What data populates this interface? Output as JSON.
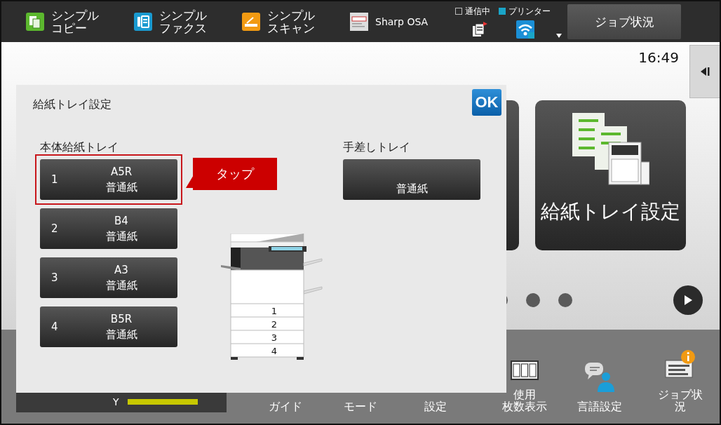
{
  "top_bar": {
    "apps": [
      {
        "label": [
          "シンプル",
          "コピー"
        ],
        "kind": "copy"
      },
      {
        "label": [
          "シンプル",
          "ファクス"
        ],
        "kind": "fax"
      },
      {
        "label": [
          "シンプル",
          "スキャン"
        ],
        "kind": "scan"
      },
      {
        "label": [
          "Sharp OSA"
        ],
        "kind": "osa"
      }
    ],
    "status": [
      {
        "label": "通信中",
        "active": false
      },
      {
        "label": "プリンター",
        "active": true
      }
    ],
    "job_status_button": "ジョブ状況"
  },
  "clock": "16:49",
  "tile": {
    "label": "給紙トレイ設定"
  },
  "bottom_bar": {
    "toner": {
      "label": "Y",
      "level": 1.0
    },
    "shortcuts": [
      {
        "label": [
          "ガイド"
        ],
        "kind": "none"
      },
      {
        "label": [
          "モード"
        ],
        "kind": "none"
      },
      {
        "label": [
          "設定"
        ],
        "kind": "none"
      },
      {
        "label": [
          "使用",
          "枚数表示"
        ],
        "kind": "counter"
      },
      {
        "label": [
          "言語設定"
        ],
        "kind": "language"
      },
      {
        "label": [
          "ジョブ状",
          "況"
        ],
        "kind": "job"
      }
    ]
  },
  "dialog": {
    "title": "給紙トレイ設定",
    "ok": "OK",
    "main_trays": {
      "heading": "本体給紙トレイ",
      "trays": [
        {
          "number": "1",
          "size": "A5R",
          "type": "普通紙",
          "selected": true
        },
        {
          "number": "2",
          "size": "B4",
          "type": "普通紙",
          "selected": false
        },
        {
          "number": "3",
          "size": "A3",
          "type": "普通紙",
          "selected": false
        },
        {
          "number": "4",
          "size": "B5R",
          "type": "普通紙",
          "selected": false
        }
      ]
    },
    "callout": "タップ",
    "printer_tray_labels": [
      "1",
      "2",
      "3",
      "4"
    ],
    "bypass": {
      "heading": "手差しトレイ",
      "type": "普通紙"
    }
  }
}
